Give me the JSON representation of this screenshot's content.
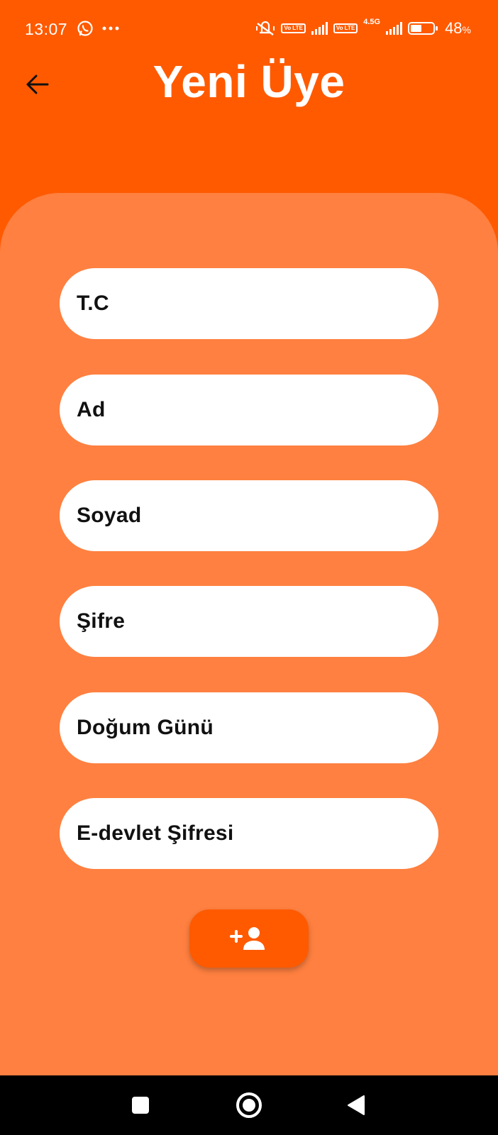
{
  "status_bar": {
    "time": "13:07",
    "battery_percent": "48",
    "battery_unit": "%",
    "network_label": "4.5G",
    "volte_label": "Vo LTE"
  },
  "header": {
    "title": "Yeni Üye"
  },
  "form": {
    "fields": [
      {
        "label": "T.C"
      },
      {
        "label": "Ad"
      },
      {
        "label": "Soyad"
      },
      {
        "label": "Şifre"
      },
      {
        "label": "Doğum Günü"
      },
      {
        "label": "E-devlet Şifresi"
      }
    ],
    "submit_icon": "person-add-icon"
  },
  "colors": {
    "header_bg": "#FF5A00",
    "card_bg": "#FF8040",
    "field_bg": "#FFFFFF",
    "button_bg": "#FF5A00"
  }
}
